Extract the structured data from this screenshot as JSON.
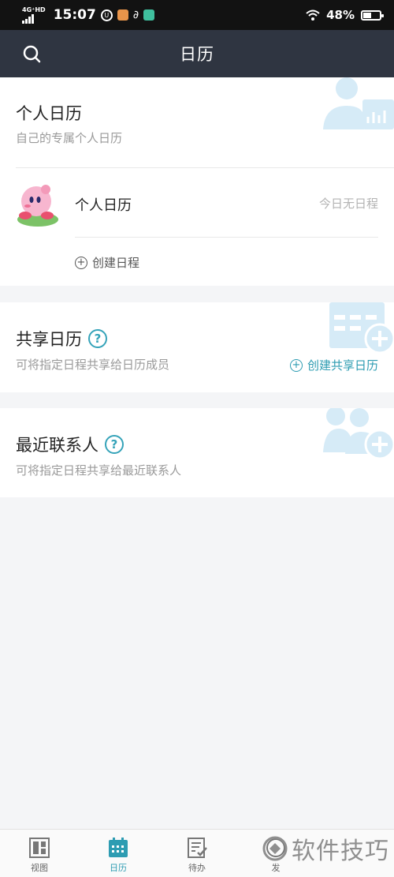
{
  "status_bar": {
    "network": "4G⁺HD",
    "time": "15:07",
    "battery": "48%",
    "battery_level": 0.48
  },
  "header": {
    "title": "日历",
    "search_icon": "search-icon"
  },
  "personal": {
    "title": "个人日历",
    "subtitle": "自己的专属个人日历",
    "calendar_name": "个人日历",
    "status": "今日无日程",
    "create_label": "创建日程"
  },
  "shared": {
    "title": "共享日历",
    "subtitle": "可将指定日程共享给日历成员",
    "create_label": "创建共享日历",
    "help": "?"
  },
  "contacts": {
    "title": "最近联系人",
    "subtitle": "可将指定日程共享给最近联系人",
    "help": "?"
  },
  "bottom_nav": {
    "items": [
      {
        "label": "视图",
        "icon": "view-icon"
      },
      {
        "label": "日历",
        "icon": "calendar-icon"
      },
      {
        "label": "待办",
        "icon": "todo-icon"
      },
      {
        "label": "发",
        "icon": "send-icon"
      }
    ],
    "active": "日历"
  },
  "watermark": {
    "text": "软件技巧"
  },
  "colors": {
    "header_bg": "#2f3541",
    "accent": "#2d9cb2",
    "watermark_blue": "#d6ebf7"
  }
}
